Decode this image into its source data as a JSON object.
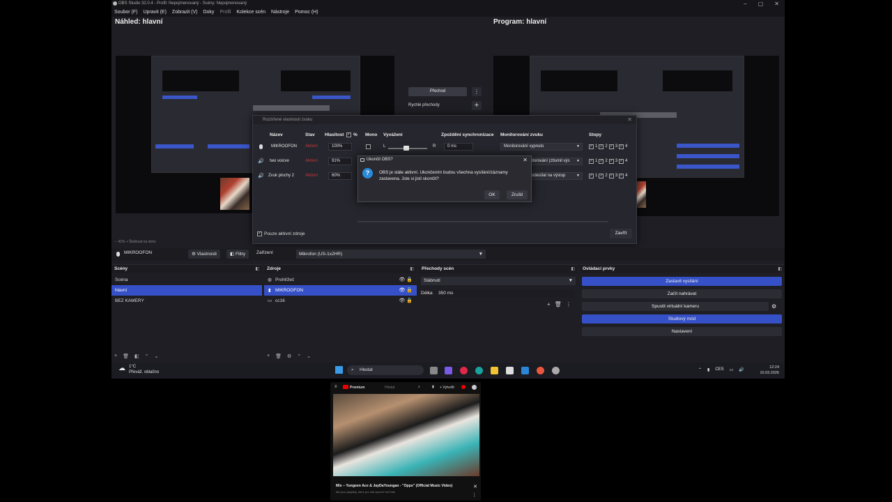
{
  "window": {
    "title": "OBS Studio 32.0.4 - Profil: Nepojmenovaný - Scény: Nepojmenovaný",
    "controls": [
      "–",
      "▢",
      "✕"
    ]
  },
  "menu": [
    "Soubor (F)",
    "Upravit (E)",
    "Zobrazit (V)",
    "Doky",
    "Profil",
    "Kolekce scén",
    "Nástroje",
    "Pomoc (H)"
  ],
  "preview": {
    "label": "Náhled: hlavní"
  },
  "program": {
    "label": "Program: hlavní"
  },
  "transition": {
    "button": "Přechod",
    "quick": "Rychlé přechody"
  },
  "advanced_audio": {
    "title": "Rozšířené vlastnosti zvuku",
    "headers": {
      "name": "Název",
      "status": "Stav",
      "volume": "Hlasitost",
      "percent": "%",
      "mono": "Mono",
      "balance": "Vyvážení",
      "sync": "Zpoždění synchronizace",
      "monitor": "Monitorování zvuku",
      "tracks": "Stopy"
    },
    "rows": [
      {
        "name": "MIKROOFON",
        "status": "Aktivní",
        "volume": "100%",
        "sync": "0 ms",
        "monitor": "Monitorování vypnuto",
        "balance_l": "L",
        "balance_r": "R"
      },
      {
        "name": "two voicve",
        "status": "Aktivní",
        "volume": "91%",
        "monitor": "itorování (ztlumit výs"
      },
      {
        "name": "Zvuk plochy 2",
        "status": "Aktivní",
        "volume": "60%",
        "monitor": "odesílat na výstup"
      }
    ],
    "track_labels": [
      "1",
      "2",
      "3",
      "4"
    ],
    "active_only": "Pouze aktivní zdroje",
    "close": "Zavřít"
  },
  "quit_dialog": {
    "title": "Ukončit OBS?",
    "message": "OBS je stále aktivní. Ukončením budou všechna vysílání/záznamy zastavena. Jste si jisti skončit?",
    "ok": "OK",
    "cancel": "Zrušit"
  },
  "toolbar": {
    "source": "MIKROOFON",
    "properties": "Vlastnosti",
    "filters": "Filtry",
    "device_label": "Zařízení",
    "device": "Mikrofon (US-1x2HR)"
  },
  "scenes": {
    "title": "Scény",
    "items": [
      "Scéna",
      "hlavní",
      "BEZ KAMERY"
    ]
  },
  "sources": {
    "title": "Zdroje",
    "items": [
      "Prohlížeč",
      "MIKROOFON",
      "cc16"
    ]
  },
  "transitions_dock": {
    "title": "Přechody scén",
    "type": "Slábnutí",
    "duration_label": "Délka",
    "duration": "350 ms"
  },
  "controls": {
    "title": "Ovládací prvky",
    "buttons": [
      "Zastavit vysílání",
      "Začít nahrávat",
      "Spustit virtuální kameru",
      "Studiový mód",
      "Nastavení"
    ]
  },
  "preview_footer": {
    "zoom": "41%",
    "scale": "Škálovat na okno"
  },
  "weather": {
    "temp": "1°C",
    "desc": "Převáž. oblačno"
  },
  "taskbar": {
    "search": "Hledat",
    "lang": "CES",
    "time": "12:24",
    "date": "10.03.2026"
  },
  "youtube": {
    "premium": "Premium",
    "search": "Hledat",
    "create": "Vytvořit",
    "title": "Mix – Yungeen Ace & JayDaYoungan - \"Opps\" (Official Music Video)",
    "sub": "Mix jsou playlisty, které pro vás vytvořil YouTube"
  },
  "colors": {
    "accent": "#3651c7",
    "status_red": "#c43a3a",
    "quit_icon": "#2a8ad8"
  }
}
